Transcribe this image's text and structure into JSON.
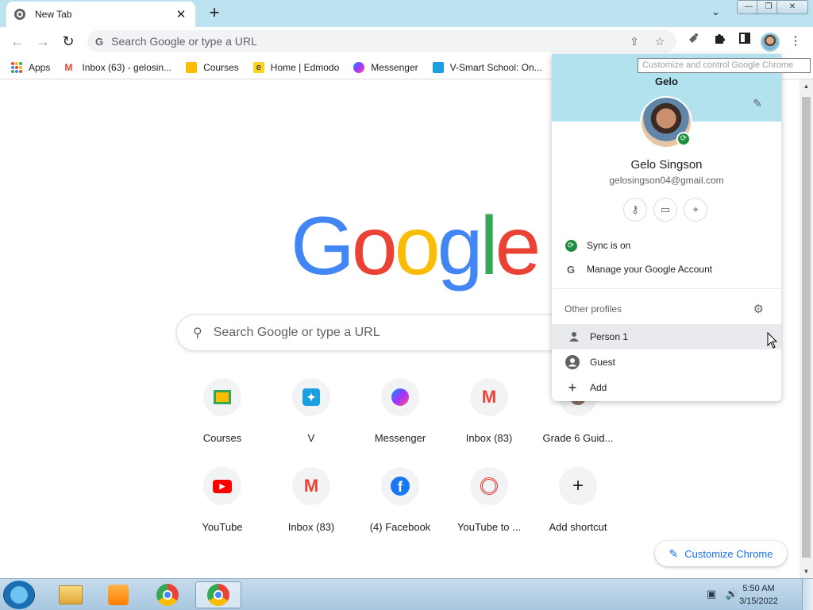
{
  "browser": {
    "tab_title": "New Tab",
    "tab_close": "✕",
    "new_tab": "+",
    "tab_search": "⌄",
    "window_controls": {
      "minimize": "—",
      "restore": "❐",
      "close": "✕"
    }
  },
  "toolbar": {
    "back": "←",
    "forward": "→",
    "reload": "↻",
    "omnibox_placeholder": "Search Google or type a URL",
    "share": "⇪",
    "star": "☆",
    "menu": "⋮"
  },
  "bookmarks": [
    {
      "label": "Apps",
      "icon": "apps-grid-icon"
    },
    {
      "label": "Inbox (63) - gelosin...",
      "icon": "gmail-icon",
      "color": "#ea4335"
    },
    {
      "label": "Courses",
      "icon": "classroom-icon",
      "color": "#fbbc04"
    },
    {
      "label": "Home | Edmodo",
      "icon": "edmodo-icon",
      "color": "#f9d423"
    },
    {
      "label": "Messenger",
      "icon": "messenger-icon",
      "color": "#a142f4"
    },
    {
      "label": "V-Smart School: On...",
      "icon": "vsmart-icon",
      "color": "#1aa0e0"
    }
  ],
  "bookmarks_overflow": "»",
  "tooltip": "Customize and control Google Chrome",
  "logo": {
    "letters": [
      "G",
      "o",
      "o",
      "g",
      "l",
      "e"
    ],
    "colors": [
      "#4285f4",
      "#ea4335",
      "#fbbc05",
      "#4285f4",
      "#34a853",
      "#ea4335"
    ]
  },
  "search": {
    "placeholder": "Search Google or type a URL",
    "icon": "⚲"
  },
  "shortcuts_row1": [
    {
      "label": "Courses",
      "glyph": "▣",
      "color": "#fbbc04"
    },
    {
      "label": "V",
      "glyph": "V",
      "color": "#1aa0e0"
    },
    {
      "label": "Messenger",
      "glyph": "⚡",
      "color": "#a142f4"
    },
    {
      "label": "Inbox (83)",
      "glyph": "M",
      "color": "#ea4335"
    },
    {
      "label": "Grade 6 Guid...",
      "glyph": "●",
      "color": "#8d6e63"
    }
  ],
  "shortcuts_row2": [
    {
      "label": "YouTube",
      "glyph": "▶",
      "color": "#ff0000"
    },
    {
      "label": "Inbox (83)",
      "glyph": "M",
      "color": "#ea4335"
    },
    {
      "label": "(4) Facebook",
      "glyph": "f",
      "color": "#1877f2"
    },
    {
      "label": "YouTube to ...",
      "glyph": "◎",
      "color": "#e53935"
    },
    {
      "label": "Add shortcut",
      "glyph": "+",
      "color": "#202124"
    }
  ],
  "customize": {
    "label": "Customize Chrome",
    "icon": "✎"
  },
  "profile_panel": {
    "profile_name": "Gelo",
    "full_name": "Gelo Singson",
    "email": "gelosingson04@gmail.com",
    "edit_icon": "✎",
    "sync_badge": "⟳",
    "quick_actions": [
      {
        "icon": "key-icon",
        "glyph": "⚷"
      },
      {
        "icon": "card-icon",
        "glyph": "▭"
      },
      {
        "icon": "location-icon",
        "glyph": "⌖"
      }
    ],
    "sync_label": "Sync is on",
    "manage_label": "Manage your Google Account",
    "other_profiles_title": "Other profiles",
    "settings_icon": "⚙",
    "profiles": [
      {
        "label": "Person 1",
        "glyph": "👤"
      },
      {
        "label": "Guest",
        "glyph": "◉"
      },
      {
        "label": "Add",
        "glyph": "+"
      }
    ]
  },
  "taskbar": {
    "time": "5:50 AM",
    "date": "3/15/2022"
  }
}
